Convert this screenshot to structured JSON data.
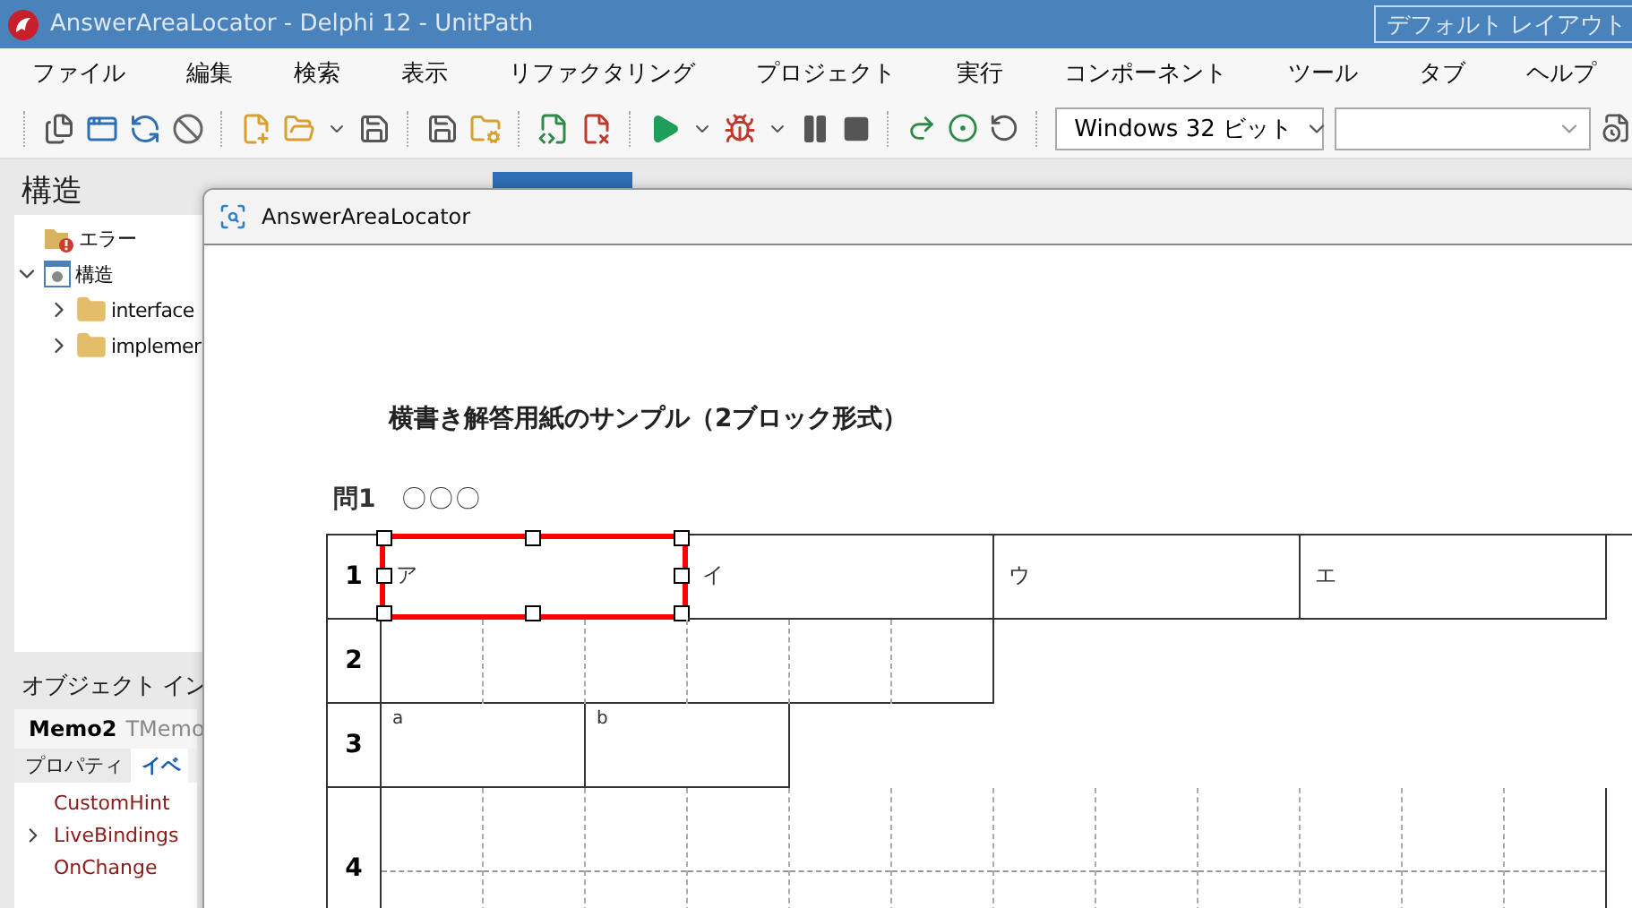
{
  "app_title": "AnswerAreaLocator - Delphi 12 - UnitPath",
  "layout_button": "デフォルト レイアウト",
  "menu": [
    "ファイル",
    "編集",
    "検索",
    "表示",
    "リファクタリング",
    "プロジェクト",
    "実行",
    "コンポーネント",
    "ツール",
    "タブ",
    "ヘルプ"
  ],
  "toolbar": {
    "platform": "Windows 32 ビット"
  },
  "structure_panel": {
    "title": "構造",
    "tree": [
      {
        "label": "エラー",
        "kind": "error"
      },
      {
        "label": "構造",
        "kind": "structure",
        "expanded": true,
        "children": [
          {
            "label": "interface",
            "kind": "folder",
            "expanded": false
          },
          {
            "label": "implemer",
            "kind": "folder",
            "expanded": false
          }
        ]
      }
    ]
  },
  "object_inspector": {
    "title": "オブジェクト イン",
    "component": "Memo2",
    "component_type": "TMemo",
    "tabs": [
      {
        "label": "プロパティ",
        "selected": false
      },
      {
        "label": "イベ",
        "selected": true
      }
    ],
    "events": [
      {
        "name": "CustomHint",
        "expandable": false
      },
      {
        "name": "LiveBindings",
        "expandable": true
      },
      {
        "name": "OnChange",
        "expandable": false
      }
    ]
  },
  "locator_window": {
    "title": "AnswerAreaLocator",
    "sheet": {
      "title": "横書き解答用紙のサンプル（2ブロック形式）",
      "question_number": "問1",
      "question_text": "〇〇〇",
      "rows": [
        {
          "number": "1",
          "kind": "wide_cells",
          "cells": [
            {
              "label": "ア",
              "selected": true
            },
            {
              "label": "イ",
              "selected": false
            },
            {
              "label": "ウ",
              "selected": false
            },
            {
              "label": "エ",
              "selected": false
            }
          ]
        },
        {
          "number": "2",
          "kind": "grid_half"
        },
        {
          "number": "3",
          "kind": "narrow_cells",
          "cells": [
            {
              "label": "a",
              "selected": false
            },
            {
              "label": "b",
              "selected": false
            }
          ]
        },
        {
          "number": "4",
          "kind": "grid_full"
        }
      ]
    }
  }
}
